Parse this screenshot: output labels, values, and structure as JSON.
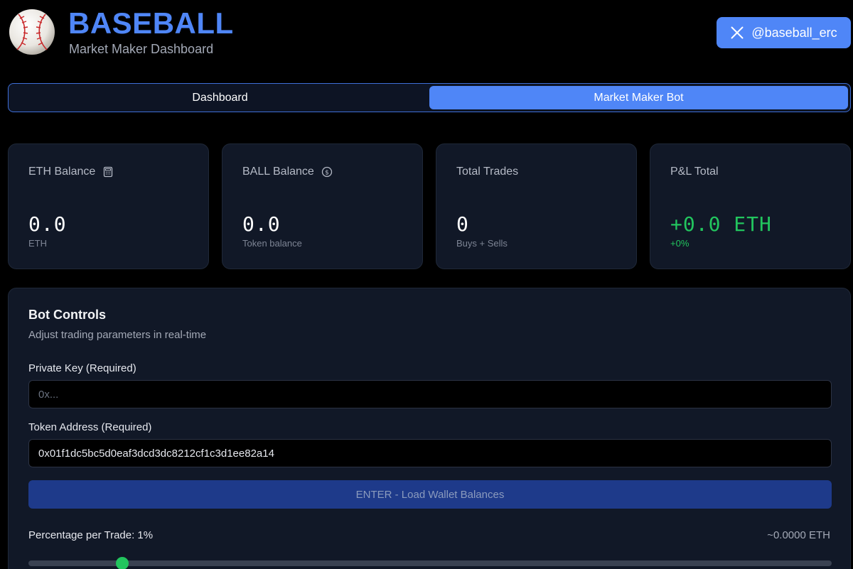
{
  "header": {
    "title": "BASEBALL",
    "subtitle": "Market Maker Dashboard",
    "logo_icon": "baseball-icon",
    "social_handle": "@baseball_erc",
    "social_icon": "x-logo-icon"
  },
  "tabs": [
    {
      "label": "Dashboard",
      "active": false
    },
    {
      "label": "Market Maker Bot",
      "active": true
    }
  ],
  "stats": [
    {
      "label": "ETH Balance",
      "icon": "calculator-icon",
      "value": "0.0",
      "sub": "ETH"
    },
    {
      "label": "BALL Balance",
      "icon": "dollar-circle-icon",
      "value": "0.0",
      "sub": "Token balance"
    },
    {
      "label": "Total Trades",
      "value": "0",
      "sub": "Buys + Sells"
    },
    {
      "label": "P&L Total",
      "value": "+0.0 ETH",
      "sub": "+0%"
    }
  ],
  "bot_controls": {
    "title": "Bot Controls",
    "description": "Adjust trading parameters in real-time",
    "private_key": {
      "label": "Private Key (Required)",
      "placeholder": "0x...",
      "value": ""
    },
    "token_address": {
      "label": "Token Address (Required)",
      "value": "0x01f1dc5bc5d0eaf3dcd3dc8212cf1c3d1ee82a14"
    },
    "load_button": "ENTER - Load Wallet Balances",
    "percentage_label": "Percentage per Trade: 1%",
    "percentage_eth": "~0.0000 ETH",
    "slider_fraction": 0.117
  },
  "colors": {
    "accent": "#4f86f7",
    "positive": "#22c55e",
    "card_bg": "#111827",
    "button_disabled": "#1e3a8a"
  }
}
